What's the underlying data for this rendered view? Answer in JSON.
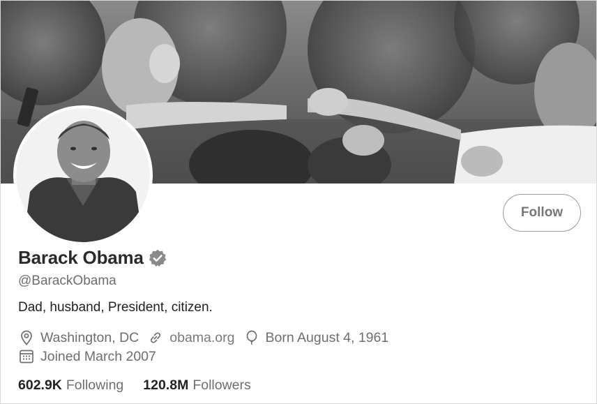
{
  "profile": {
    "name": "Barack Obama",
    "handle": "@BarackObama",
    "bio": "Dad, husband, President, citizen.",
    "location": "Washington, DC",
    "website": "obama.org",
    "birthday": "Born August 4, 1961",
    "joined": "Joined March 2007",
    "verified": true
  },
  "actions": {
    "follow_label": "Follow"
  },
  "stats": {
    "following_count": "602.9K",
    "following_label": "Following",
    "followers_count": "120.8M",
    "followers_label": "Followers"
  },
  "icons": {
    "verified": "verified-badge-icon",
    "location": "location-pin-icon",
    "website": "link-icon",
    "birthday": "balloon-icon",
    "joined": "calendar-icon"
  },
  "colors": {
    "text_primary": "#2a2a2a",
    "text_secondary": "#6e6e6e",
    "border": "#9a9a9a"
  }
}
